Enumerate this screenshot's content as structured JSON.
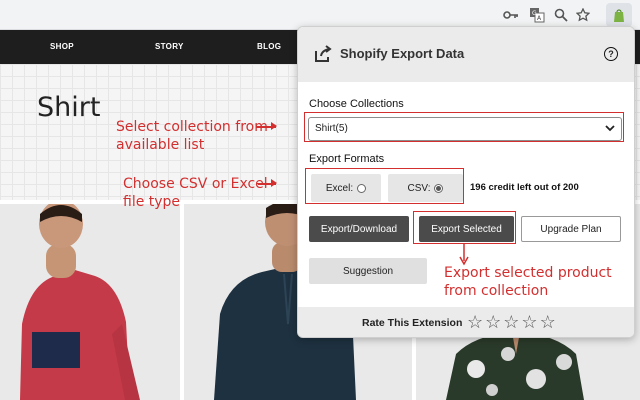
{
  "browser": {
    "icons": [
      "key-icon",
      "translate-icon",
      "zoom-icon",
      "star-icon",
      "extension-icon"
    ]
  },
  "shop": {
    "nav": [
      "SHOP",
      "STORY",
      "BLOG"
    ],
    "page_title": "Shirt"
  },
  "popup": {
    "title": "Shopify Export Data",
    "help_label": "?",
    "collections_label": "Choose Collections",
    "collection_selected": "Shirt(5)",
    "formats_label": "Export Formats",
    "excel_label": "Excel:",
    "csv_label": "CSV:",
    "selected_format": "CSV",
    "credits": "196 credit left out of 200",
    "export_download": "Export/Download",
    "export_selected": "Export Selected",
    "upgrade_plan": "Upgrade Plan",
    "suggestion": "Suggestion",
    "rate_label": "Rate This Extension",
    "rating": 0,
    "max_rating": 5
  },
  "annotations": {
    "collection_note": [
      "Select collection from",
      "available list"
    ],
    "format_note": [
      "Choose CSV or Excel",
      "file type"
    ],
    "export_note": [
      "Export selected product",
      "from collection"
    ],
    "color": "#d32f2f"
  }
}
